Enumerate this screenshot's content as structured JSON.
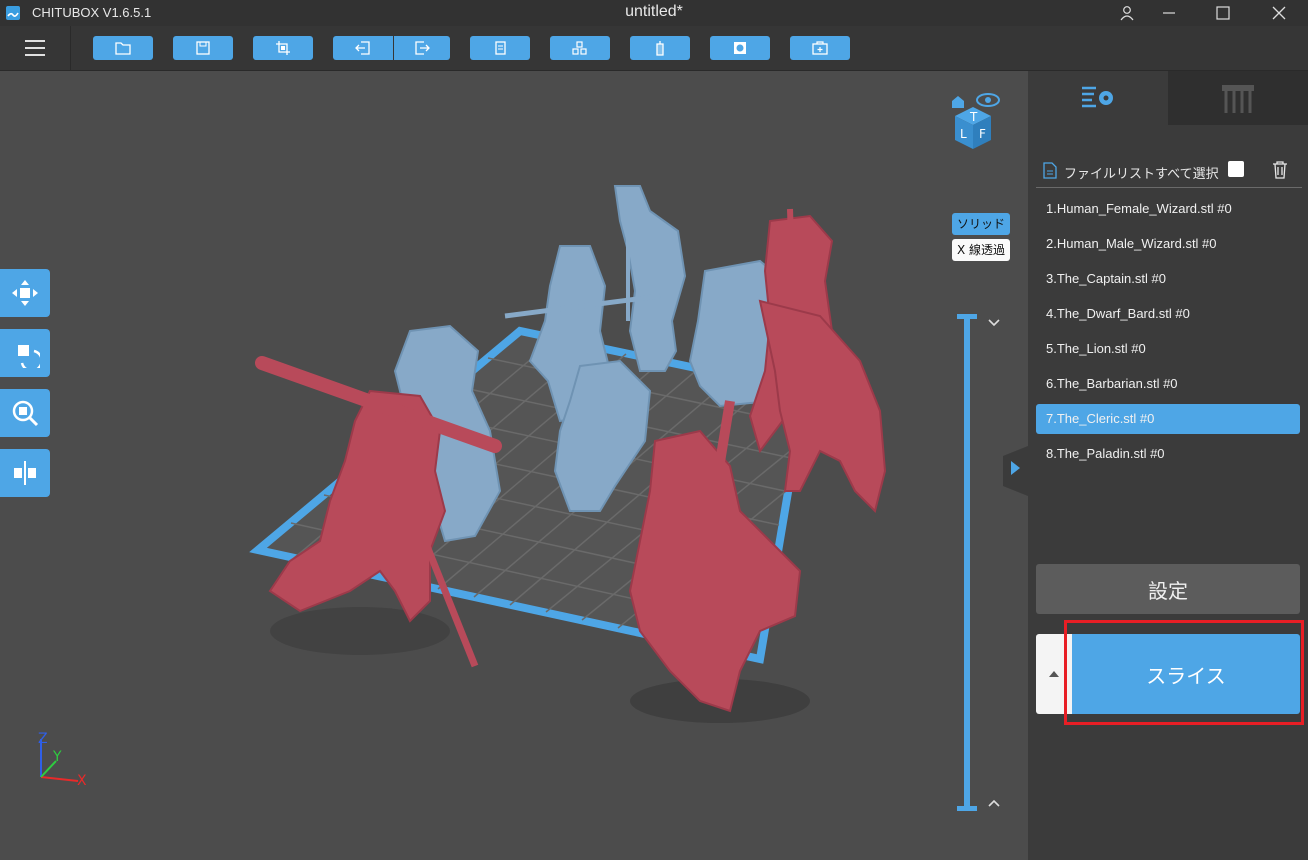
{
  "titlebar": {
    "app_title": "CHITUBOX V1.6.5.1",
    "doc_title": "untitled*",
    "icons": [
      "user-icon",
      "minimize-icon",
      "maximize-icon",
      "close-icon"
    ]
  },
  "toolbar": {
    "icons": [
      "open-icon",
      "save-icon",
      "crop-icon",
      "import-icon",
      "export-icon",
      "copy-icon",
      "arrange-icon",
      "support-icon",
      "hollow-icon",
      "toolbox-icon"
    ]
  },
  "viewport": {
    "view_mode": {
      "solid_label": "ソリッド",
      "xray_label": "X 線透過"
    },
    "axes": {
      "x": "X",
      "y": "Y",
      "z": "Z"
    },
    "cube_faces": {
      "top": "T",
      "left": "L",
      "front": "F"
    },
    "colors": {
      "selected_model": "#b84a5a",
      "unselected_model": "#87a9c8",
      "plate": "#4ea6e6"
    }
  },
  "sidebar": {
    "select_all_label": "ファイルリストすべて選択",
    "files": [
      "1.Human_Female_Wizard.stl #0",
      "2.Human_Male_Wizard.stl #0",
      "3.The_Captain.stl #0",
      "4.The_Dwarf_Bard.stl #0",
      "5.The_Lion.stl #0",
      "6.The_Barbarian.stl #0",
      "7.The_Cleric.stl #0",
      "8.The_Paladin.stl #0"
    ],
    "selected_index": 6,
    "settings_label": "設定",
    "slice_label": "スライス",
    "accent": "#4ea6e6"
  }
}
